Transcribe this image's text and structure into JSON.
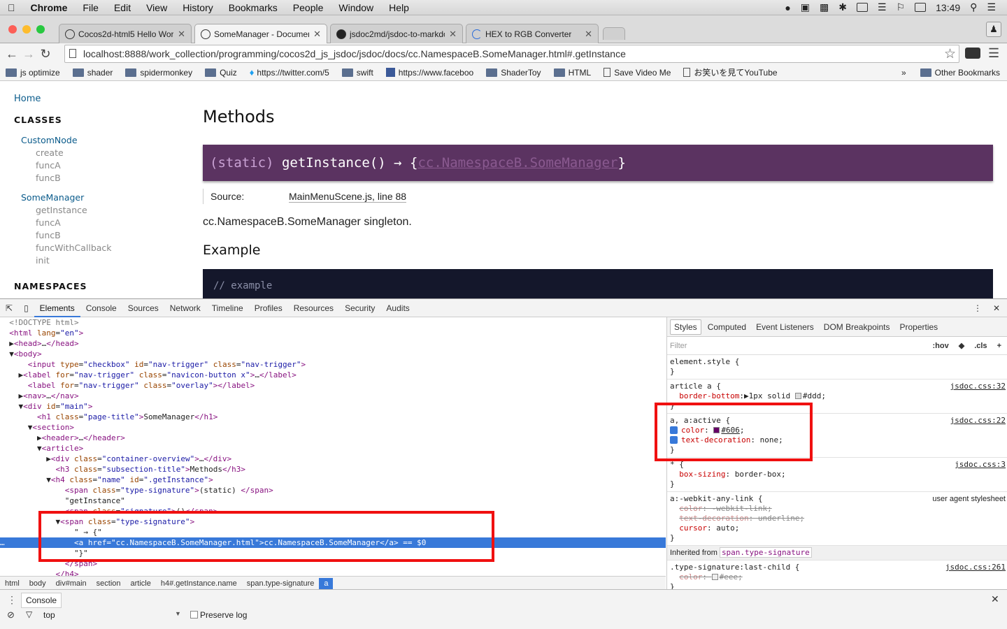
{
  "menubar": {
    "app": "Chrome",
    "items": [
      "File",
      "Edit",
      "View",
      "History",
      "Bookmarks",
      "People",
      "Window",
      "Help"
    ],
    "clock": "13:49"
  },
  "tabs": [
    {
      "title": "Cocos2d-html5 Hello World",
      "active": false
    },
    {
      "title": "SomeManager - Documentation",
      "active": true
    },
    {
      "title": "jsdoc2md/jsdoc-to-markdown",
      "active": false
    },
    {
      "title": "HEX to RGB Converter",
      "active": false
    }
  ],
  "address": {
    "url": "localhost:8888/work_collection/programming/cocos2d_js_jsdoc/jsdoc/docs/cc.NamespaceB.SomeManager.html#.getInstance"
  },
  "bookmarks": {
    "items": [
      {
        "label": "js optimize",
        "type": "folder"
      },
      {
        "label": "shader",
        "type": "folder"
      },
      {
        "label": "spidermonkey",
        "type": "folder"
      },
      {
        "label": "Quiz",
        "type": "folder"
      },
      {
        "label": "https://twitter.com/5",
        "type": "twitter"
      },
      {
        "label": "swift",
        "type": "folder"
      },
      {
        "label": "https://www.faceboo",
        "type": "facebook"
      },
      {
        "label": "ShaderToy",
        "type": "folder"
      },
      {
        "label": "HTML",
        "type": "folder"
      },
      {
        "label": "Save Video Me",
        "type": "page"
      },
      {
        "label": "お笑いを見てYouTube",
        "type": "page"
      }
    ],
    "overflow": "»",
    "other": "Other Bookmarks"
  },
  "sidenav": {
    "home": "Home",
    "classes_heading": "CLASSES",
    "classes": [
      {
        "name": "CustomNode",
        "members": [
          "create",
          "funcA",
          "funcB"
        ]
      },
      {
        "name": "SomeManager",
        "members": [
          "getInstance",
          "funcA",
          "funcB",
          "funcWithCallback",
          "init"
        ]
      }
    ],
    "namespaces_heading": "NAMESPACES"
  },
  "content": {
    "methods_heading": "Methods",
    "signature": {
      "static": "(static)",
      "name": "getInstance()",
      "arrow": "→ {",
      "type": "cc.NamespaceB.SomeManager",
      "close": "}"
    },
    "source_label": "Source:",
    "source_link": "MainMenuScene.js, line 88",
    "description": "cc.NamespaceB.SomeManager singleton.",
    "example_heading": "Example",
    "code_comment": "// example"
  },
  "devtools": {
    "tabs": [
      "Elements",
      "Console",
      "Sources",
      "Network",
      "Timeline",
      "Profiles",
      "Resources",
      "Security",
      "Audits"
    ],
    "selected_tab": "Elements",
    "crumbs": [
      "html",
      "body",
      "div#main",
      "section",
      "article",
      "h4#.getInstance.name",
      "span.type-signature",
      "a"
    ],
    "styles_tabs": [
      "Styles",
      "Computed",
      "Event Listeners",
      "DOM Breakpoints",
      "Properties"
    ],
    "filter_placeholder": "Filter",
    "hov": ":hov",
    "cls": ".cls",
    "inherited_label": "Inherited from",
    "inherited_from": "span.type-signature"
  },
  "console": {
    "tab": "Console",
    "context": "top",
    "preserve_log": "Preserve log"
  },
  "colors": {
    "signature_bg": "#5b3361",
    "code_bg": "#14172b",
    "devtools_select": "#3879d9",
    "annotation": "#f01010"
  }
}
